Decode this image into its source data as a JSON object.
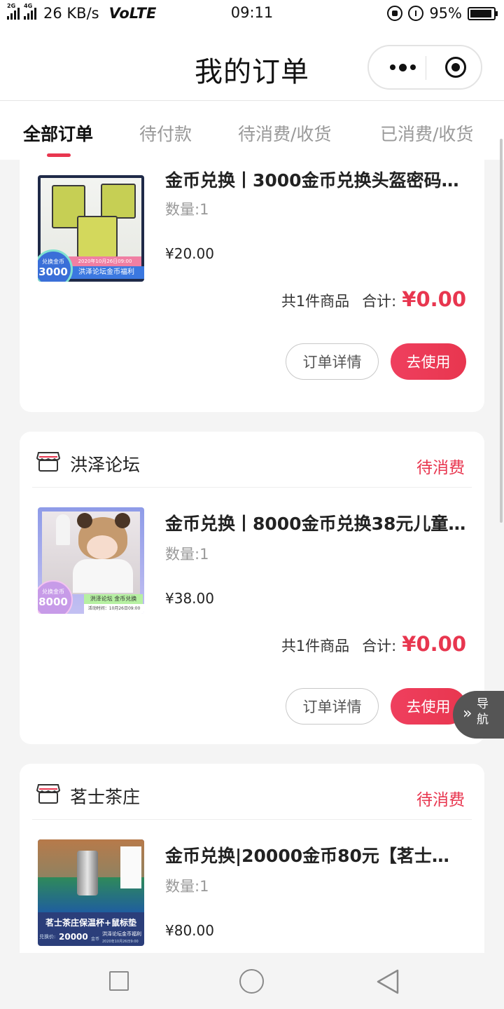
{
  "status_bar": {
    "net_tag_1": "2G",
    "net_tag_2": "4G",
    "speed": "26 KB/s",
    "volte": "VoLTE",
    "time": "09:11",
    "battery": "95%",
    "battery_level": 0.95
  },
  "header": {
    "title": "我的订单"
  },
  "tabs": [
    {
      "label": "全部订单",
      "active": true
    },
    {
      "label": "待付款",
      "active": false
    },
    {
      "label": "待消费/收货",
      "active": false
    },
    {
      "label": "已消费/收货",
      "active": false
    }
  ],
  "orders": [
    {
      "shop": "",
      "status": "",
      "product": {
        "title": "金币兑换丨3000金币兑换头盔密码…",
        "qty": "数量:1",
        "price": "¥20.00",
        "img_coin_small": "兑换金币",
        "img_coin": "3000",
        "img_date": "2020年10月26日09:00",
        "img_caption": "洪泽论坛金币福利"
      },
      "count_text": "共1件商品",
      "total_label": "合计:",
      "total": "¥0.00",
      "detail_button": "订单详情",
      "use_button": "去使用"
    },
    {
      "shop": "洪泽论坛",
      "status": "待消费",
      "product": {
        "title": "金币兑换丨8000金币兑换38元儿童…",
        "qty": "数量:1",
        "price": "¥38.00",
        "img_coin_small": "兑换金币",
        "img_coin": "8000",
        "img_date": "活动时间：10月26日09:00",
        "img_caption": "洪泽论坛 金币兑换"
      },
      "count_text": "共1件商品",
      "total_label": "合计:",
      "total": "¥0.00",
      "detail_button": "订单详情",
      "use_button": "去使用"
    },
    {
      "shop": "茗士茶庄",
      "status": "待消费",
      "product": {
        "title": "金币兑换|20000金币80元【茗士茶…",
        "qty": "数量:1",
        "price": "¥80.00",
        "img_caption": "茗士茶庄保温杯+鼠标垫",
        "img_coin_label": "兑换价:",
        "img_coin": "20000",
        "img_coin_unit": "金币",
        "img_brand": "洪泽论坛金币福利",
        "img_date": "2020年10月26日9:00"
      }
    }
  ],
  "float_nav": {
    "icon": "double-chevron-icon",
    "label": "导航"
  },
  "colors": {
    "accent": "#e8364f",
    "background": "#f4f4f4"
  }
}
